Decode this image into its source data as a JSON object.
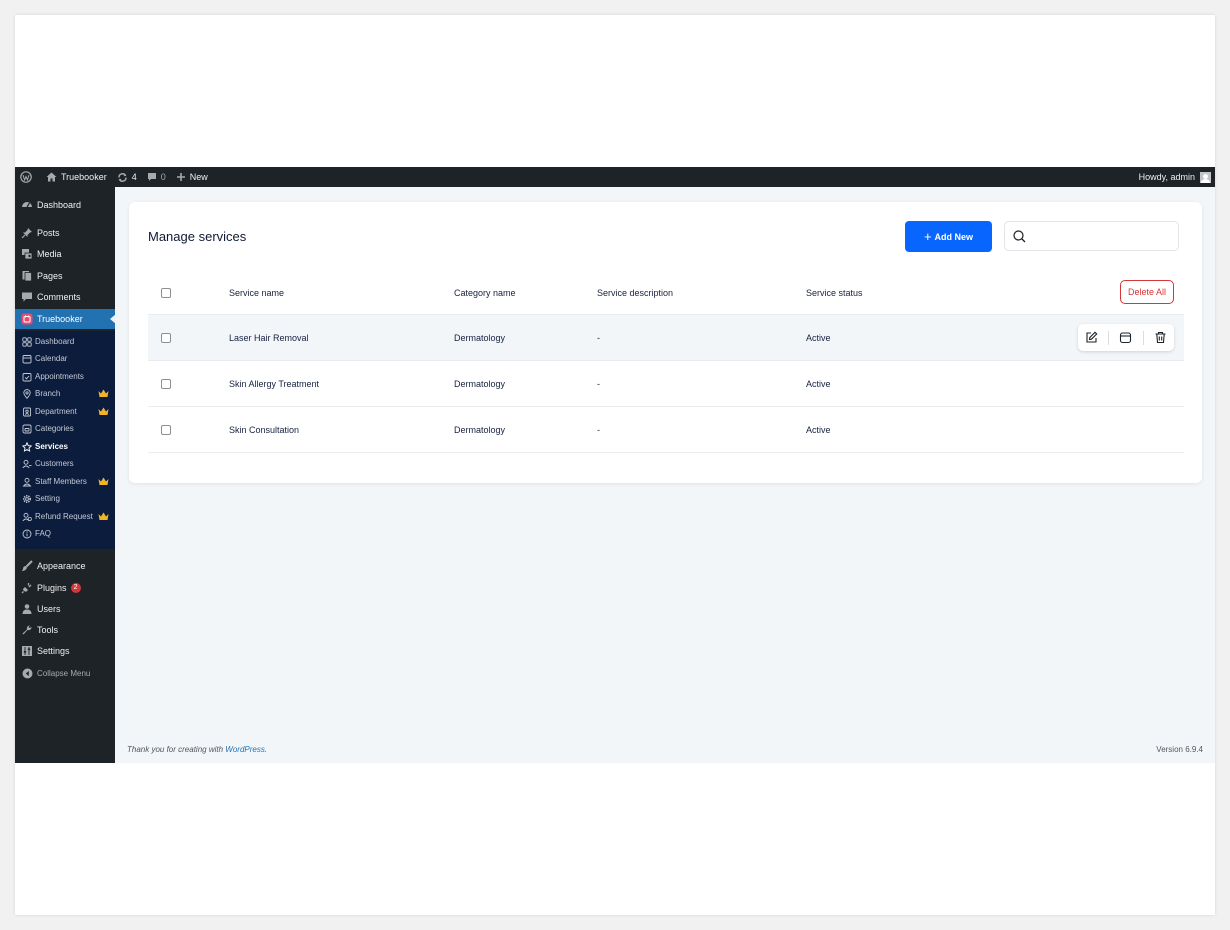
{
  "admin_bar": {
    "site_name": "Truebooker",
    "updates_count": "4",
    "comments_count": "0",
    "new_label": "New",
    "howdy": "Howdy, admin"
  },
  "sidebar": {
    "items_top": [
      {
        "label": "Dashboard",
        "icon": "dashboard-icon"
      },
      {
        "label": "Posts",
        "icon": "pin-icon"
      },
      {
        "label": "Media",
        "icon": "media-icon"
      },
      {
        "label": "Pages",
        "icon": "pages-icon"
      },
      {
        "label": "Comments",
        "icon": "comments-icon"
      },
      {
        "label": "Truebooker",
        "icon": "truebooker-icon"
      }
    ],
    "submenu": [
      {
        "label": "Dashboard",
        "icon": "grid-icon",
        "pro": false
      },
      {
        "label": "Calendar",
        "icon": "calendar-icon",
        "pro": false
      },
      {
        "label": "Appointments",
        "icon": "appointments-icon",
        "pro": false
      },
      {
        "label": "Branch",
        "icon": "location-icon",
        "pro": true
      },
      {
        "label": "Department",
        "icon": "department-icon",
        "pro": true
      },
      {
        "label": "Categories",
        "icon": "categories-icon",
        "pro": false
      },
      {
        "label": "Services",
        "icon": "services-icon",
        "pro": false
      },
      {
        "label": "Customers",
        "icon": "customers-icon",
        "pro": false
      },
      {
        "label": "Staff Members",
        "icon": "staff-icon",
        "pro": true
      },
      {
        "label": "Setting",
        "icon": "gear-icon",
        "pro": false
      },
      {
        "label": "Refund Request",
        "icon": "refund-icon",
        "pro": true
      },
      {
        "label": "FAQ",
        "icon": "info-icon",
        "pro": false
      }
    ],
    "items_bottom": [
      {
        "label": "Appearance",
        "icon": "brush-icon"
      },
      {
        "label": "Plugins",
        "icon": "plugin-icon",
        "badge": "2"
      },
      {
        "label": "Users",
        "icon": "user-icon"
      },
      {
        "label": "Tools",
        "icon": "wrench-icon"
      },
      {
        "label": "Settings",
        "icon": "settings-icon"
      }
    ],
    "collapse_label": "Collapse Menu"
  },
  "page": {
    "title": "Manage services",
    "add_new_label": "Add New",
    "search_placeholder": "",
    "delete_all_label": "Delete All"
  },
  "table": {
    "columns": [
      "Service name",
      "Category name",
      "Service description",
      "Service status"
    ],
    "rows": [
      {
        "name": "Laser Hair Removal",
        "category": "Dermatology",
        "description": "-",
        "status": "Active"
      },
      {
        "name": "Skin Allergy Treatment",
        "category": "Dermatology",
        "description": "-",
        "status": "Active"
      },
      {
        "name": "Skin Consultation",
        "category": "Dermatology",
        "description": "-",
        "status": "Active"
      }
    ]
  },
  "footer": {
    "thanks_prefix": "Thank you for creating with",
    "thanks_link": "WordPress",
    "thanks_suffix": ".",
    "version": "Version 6.9.4"
  },
  "colors": {
    "primary": "#0866ff",
    "danger": "#d63638",
    "sidebar_bg": "#1d2327",
    "submenu_bg": "#0c1c3c",
    "active_menu": "#2271b1",
    "crown": "#f0b429"
  }
}
